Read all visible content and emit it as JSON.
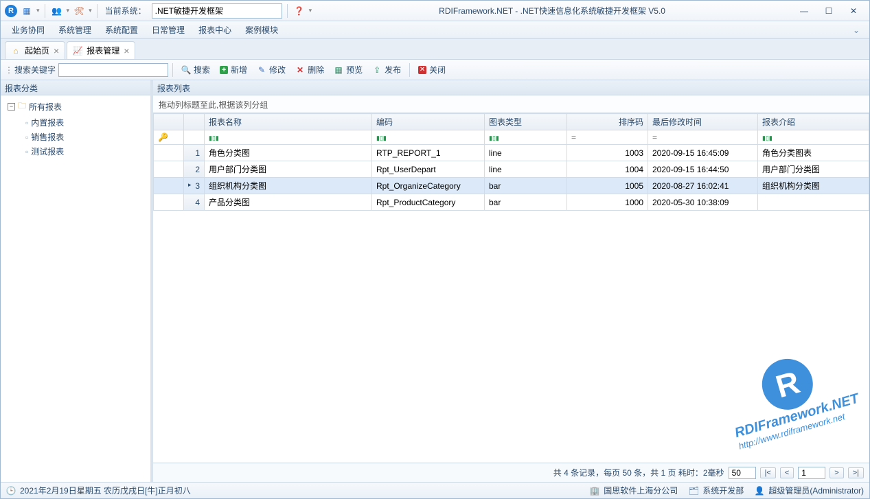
{
  "titlebar": {
    "current_system_label": "当前系统：",
    "current_system_value": ".NET敏捷开发框架",
    "app_title": "RDIFramework.NET - .NET快速信息化系统敏捷开发框架 V5.0"
  },
  "menubar": {
    "items": [
      "业务协同",
      "系统管理",
      "系统配置",
      "日常管理",
      "报表中心",
      "案例模块"
    ]
  },
  "tabs": [
    {
      "label": "起始页",
      "icon": "home-icon",
      "active": false
    },
    {
      "label": "报表管理",
      "icon": "chart-icon",
      "active": true
    }
  ],
  "toolbar": {
    "search_label": "搜索关键字",
    "search_value": "",
    "buttons": {
      "search": "搜索",
      "add": "新增",
      "edit": "修改",
      "delete": "删除",
      "preview": "预览",
      "publish": "发布",
      "close": "关闭"
    }
  },
  "left": {
    "header": "报表分类",
    "root": "所有报表",
    "children": [
      "内置报表",
      "销售报表",
      "测试报表"
    ]
  },
  "right": {
    "header": "报表列表",
    "group_hint": "拖动列标题至此,根据该列分组",
    "columns": [
      "报表名称",
      "编码",
      "图表类型",
      "排序码",
      "最后修改时间",
      "报表介绍"
    ],
    "filter_eq": "=",
    "rows": [
      {
        "n": 1,
        "name": "角色分类图",
        "code": "RTP_REPORT_1",
        "type": "line",
        "sort": 1003,
        "time": "2020-09-15 16:45:09",
        "intro": "角色分类图表",
        "sel": false
      },
      {
        "n": 2,
        "name": "用户部门分类图",
        "code": "Rpt_UserDepart",
        "type": "line",
        "sort": 1004,
        "time": "2020-09-15 16:44:50",
        "intro": "用户部门分类图",
        "sel": false
      },
      {
        "n": 3,
        "name": "组织机构分类图",
        "code": "Rpt_OrganizeCategory",
        "type": "bar",
        "sort": 1005,
        "time": "2020-08-27 16:02:41",
        "intro": "组织机构分类图",
        "sel": true
      },
      {
        "n": 4,
        "name": "产品分类图",
        "code": "Rpt_ProductCategory",
        "type": "bar",
        "sort": 1000,
        "time": "2020-05-30 10:38:09",
        "intro": "",
        "sel": false
      }
    ]
  },
  "pager": {
    "summary_prefix": "共 ",
    "record_count": "4",
    "summary_mid1": " 条记录，每页 ",
    "per_page": "50",
    "summary_mid2": " 条，共 ",
    "page_count": "1",
    "summary_mid3": " 页   耗时：",
    "elapsed": "2毫秒",
    "page_size_value": "50",
    "first": "|<",
    "prev": "<",
    "current_page": "1",
    "next": ">",
    "last": ">|"
  },
  "statusbar": {
    "date": "2021年2月19日星期五 农历戊戌日[牛]正月初八",
    "company": "国思软件上海分公司",
    "dept": "系统开发部",
    "user": "超级管理员(Administrator)"
  },
  "watermark": {
    "line1": "RDIFramework.NET",
    "line2": "http://www.rdiframework.net"
  }
}
